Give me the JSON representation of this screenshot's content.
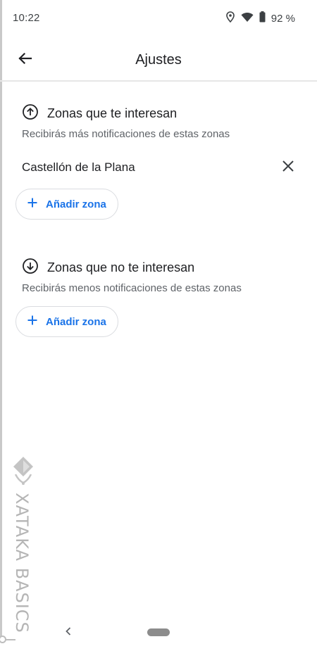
{
  "status_bar": {
    "time": "10:22",
    "battery_text": "92 %",
    "icons": [
      "location-icon",
      "wifi-icon",
      "battery-icon"
    ]
  },
  "app_bar": {
    "title": "Ajustes",
    "back_icon": "back-arrow-icon"
  },
  "interested": {
    "icon": "arrow-up-circle-icon",
    "title": "Zonas que te interesan",
    "subtitle": "Recibirás más notificaciones de estas zonas",
    "zones": [
      {
        "name": "Castellón de la Plana",
        "remove_icon": "close-icon"
      }
    ],
    "add_label": "Añadir zona"
  },
  "not_interested": {
    "icon": "arrow-down-circle-icon",
    "title": "Zonas que no te interesan",
    "subtitle": "Recibirás menos notificaciones de estas zonas",
    "add_label": "Añadir zona"
  },
  "watermark": {
    "text": "XATAKA BASICS"
  },
  "nav_bar": {
    "icons": [
      "nav-back-icon",
      "nav-home-pill"
    ]
  },
  "colors": {
    "accent": "#1a73e8",
    "text_primary": "#202124",
    "text_secondary": "#5f6368",
    "divider": "#e6e6e6"
  }
}
